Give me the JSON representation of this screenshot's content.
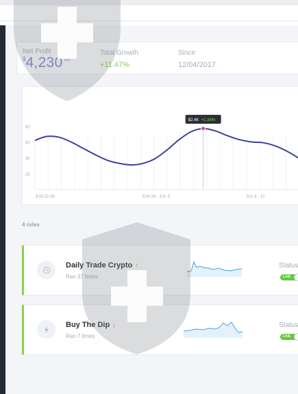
{
  "stats": {
    "net_profit_label": "Net Profit",
    "net_profit_currency": "$",
    "net_profit_value": "4,230",
    "net_profit_cents": "00",
    "total_growth_label": "Total Growth",
    "total_growth_value": "+11.47%",
    "since_label": "Since",
    "since_value": "12/04/2017"
  },
  "chart": {
    "tooltip_value": "$2.4K",
    "tooltip_change": "+2.34%",
    "accent_color": "#3a3f9e",
    "marker_color": "#e0457b"
  },
  "chart_data": {
    "type": "line",
    "y_ticks": [
      "20",
      "40",
      "60",
      "80"
    ],
    "x_tick_labels": [
      "JUN 22-28",
      "JUN 29 - JUL 5",
      "JUL 6 - 12"
    ],
    "ylim": [
      0,
      95
    ],
    "grid": true,
    "series": [
      {
        "values": [
          62,
          67,
          66,
          60,
          52,
          44,
          37,
          33,
          31,
          33,
          39,
          50,
          63,
          73,
          77,
          74,
          68,
          63,
          60,
          59,
          55,
          48,
          39
        ]
      }
    ]
  },
  "rules": {
    "count_label": "4 rules",
    "items": [
      {
        "name": "Daily Trade Crypto",
        "subtitle": "Ran 37 times",
        "direction": "up",
        "status_label": "Status",
        "toggle_label": "LIVE",
        "icon": "clock-icon"
      },
      {
        "name": "Buy The Dip",
        "subtitle": "Ran 7 times",
        "direction": "down",
        "status_label": "Status",
        "toggle_label": "LIVE",
        "icon": "lightning-icon"
      }
    ]
  }
}
